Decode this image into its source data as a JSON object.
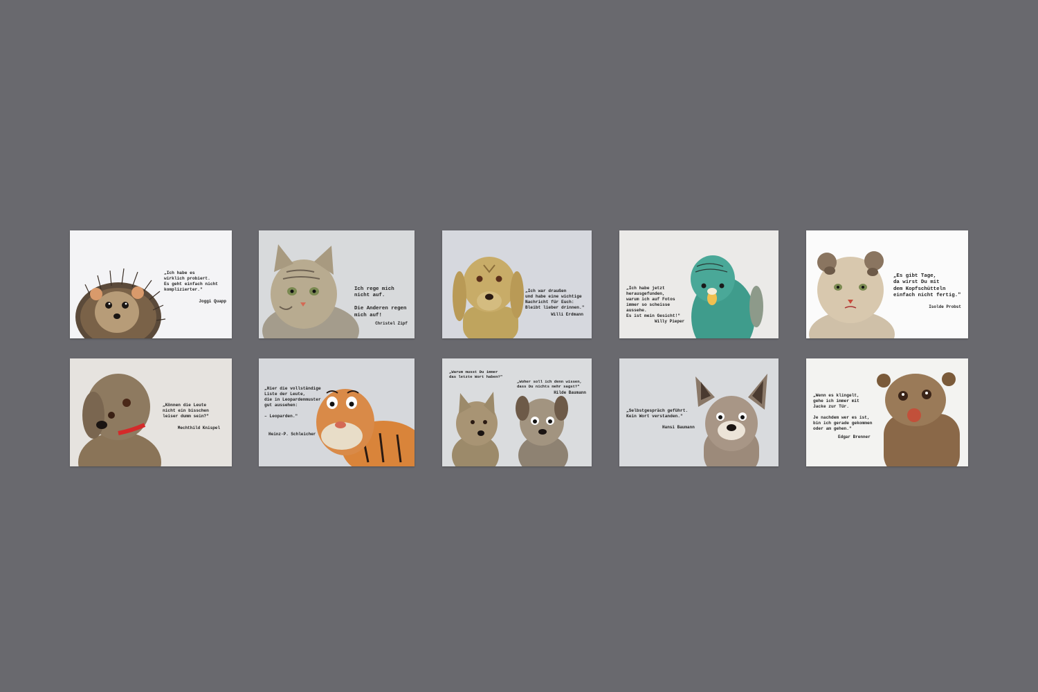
{
  "cards": [
    {
      "quote": "„Ich habe es\nwirklich probiert.\nEs geht einfach nicht\nkomplizierter.\"",
      "author": "Joggi Quapp",
      "animal": "hedgehog-plush",
      "background": "#f4f4f6"
    },
    {
      "quote": "Ich rege mich\nnicht auf.\n\nDie Anderen regen\nmich auf!",
      "author": "Christel Zipf",
      "animal": "cat-plush",
      "background": "#d8dadc"
    },
    {
      "quote": "„Ich war draußen\nund habe eine wichtige\nNachricht für Euch:\nBleibt lieber drinnen.\"",
      "author": "Willi Erdmann",
      "animal": "dog-plush",
      "background": "#d6d8de"
    },
    {
      "quote": "„Ich habe jetzt\nherausgefunden,\nwarum ich auf Fotos\nimmer so scheisse\naussehe.\nEs ist mein Gesicht!\"",
      "author": "Willy Pieper",
      "animal": "budgie-plush",
      "background": "#ebeae8"
    },
    {
      "quote": "„Es gibt Tage,\nda wirst Du mit\ndem Kopfschütteln\neinfach nicht fertig.\"",
      "author": "Isolde Probst",
      "animal": "cat-plush",
      "background": "#fbfbfb"
    },
    {
      "quote": "„Können die Leute\nnicht ein bisschen\nleiser dumm sein?\"",
      "author": "Mechthild Knispel",
      "animal": "dog-plush",
      "background": "#e6e3df"
    },
    {
      "quote": "„Hier die vollständige\nListe der Leute,\ndie in Leopardenmuster\ngut aussehen:\n\n– Leoparden.\"",
      "author": "Heinz-P. Schleicher",
      "animal": "tiger-plush",
      "background": "#d6d8dc"
    },
    {
      "quote": "„Warum musst Du immer\ndas letzte Wort haben?\"",
      "quote2": "„Woher soll ich denn wissen,\ndass Du nichts mehr sagst?\"",
      "author": "Hilde Baumann",
      "animal": "two-dog-plush",
      "background": "#dadcde"
    },
    {
      "quote": "„Selbstgespräch geführt.\nKein Wort verstanden.\"",
      "author": "Hansi Baumann",
      "animal": "dog-plush",
      "background": "#d9dbde"
    },
    {
      "quote": "„Wenn es klingelt,\ngehe ich immer mit\nJacke zur Tür.\n\nJe nachdem wer es ist,\nbin ich gerade gekommen\noder am gehen.\"",
      "author": "Edgar Brenner",
      "animal": "bear-plush",
      "background": "#f3f3f1"
    }
  ]
}
